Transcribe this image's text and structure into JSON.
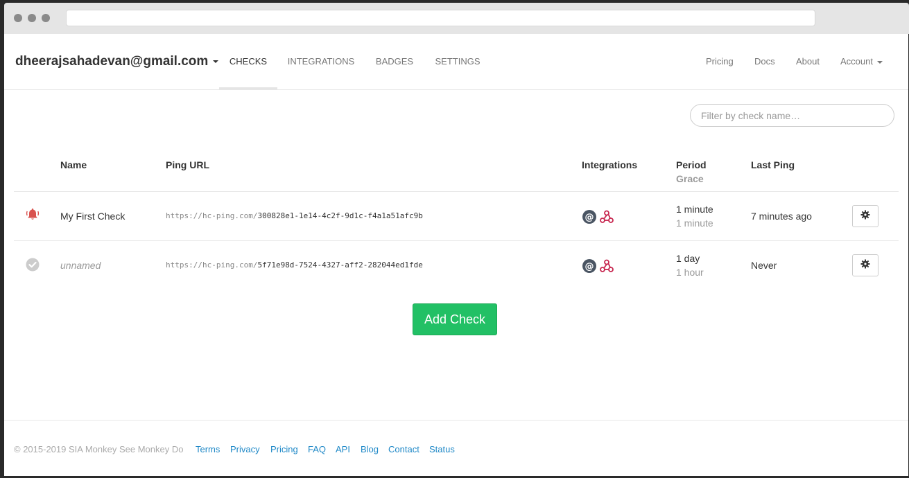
{
  "navbar": {
    "account_email": "dheerajsahadevan@gmail.com",
    "tabs": [
      {
        "label": "CHECKS"
      },
      {
        "label": "INTEGRATIONS"
      },
      {
        "label": "BADGES"
      },
      {
        "label": "SETTINGS"
      }
    ],
    "right": {
      "pricing": "Pricing",
      "docs": "Docs",
      "about": "About",
      "account": "Account"
    }
  },
  "filter": {
    "placeholder": "Filter by check name…"
  },
  "table": {
    "headers": {
      "name": "Name",
      "ping_url": "Ping URL",
      "integrations": "Integrations",
      "period": "Period",
      "grace": "Grace",
      "last_ping": "Last Ping"
    },
    "rows": [
      {
        "status": "down",
        "name": "My First Check",
        "url_base": "https://hc-ping.com/",
        "url_code": "300828e1-1e14-4c2f-9d1c-f4a1a51afc9b",
        "period": "1 minute",
        "grace": "1 minute",
        "last_ping": "7 minutes ago"
      },
      {
        "status": "up",
        "name": "unnamed",
        "url_base": "https://hc-ping.com/",
        "url_code": "5f71e98d-7524-4327-aff2-282044ed1fde",
        "period": "1 day",
        "grace": "1 hour",
        "last_ping": "Never"
      }
    ]
  },
  "add_check": "Add Check",
  "footer": {
    "copyright": "© 2015-2019 SIA Monkey See Monkey Do",
    "links": [
      "Terms",
      "Privacy",
      "Pricing",
      "FAQ",
      "API",
      "Blog",
      "Contact",
      "Status"
    ]
  },
  "colors": {
    "down": "#d9534f",
    "up": "#cccccc",
    "accent": "#22c065",
    "link": "#1e88c7",
    "email_icon": "#4a5563",
    "webhook_icon": "#c7254e"
  },
  "icons": {
    "status_down": "bell-icon",
    "status_up": "check-circle-icon",
    "integration_email": "email-at-icon",
    "integration_webhook": "webhook-icon",
    "settings": "gear-icon"
  }
}
